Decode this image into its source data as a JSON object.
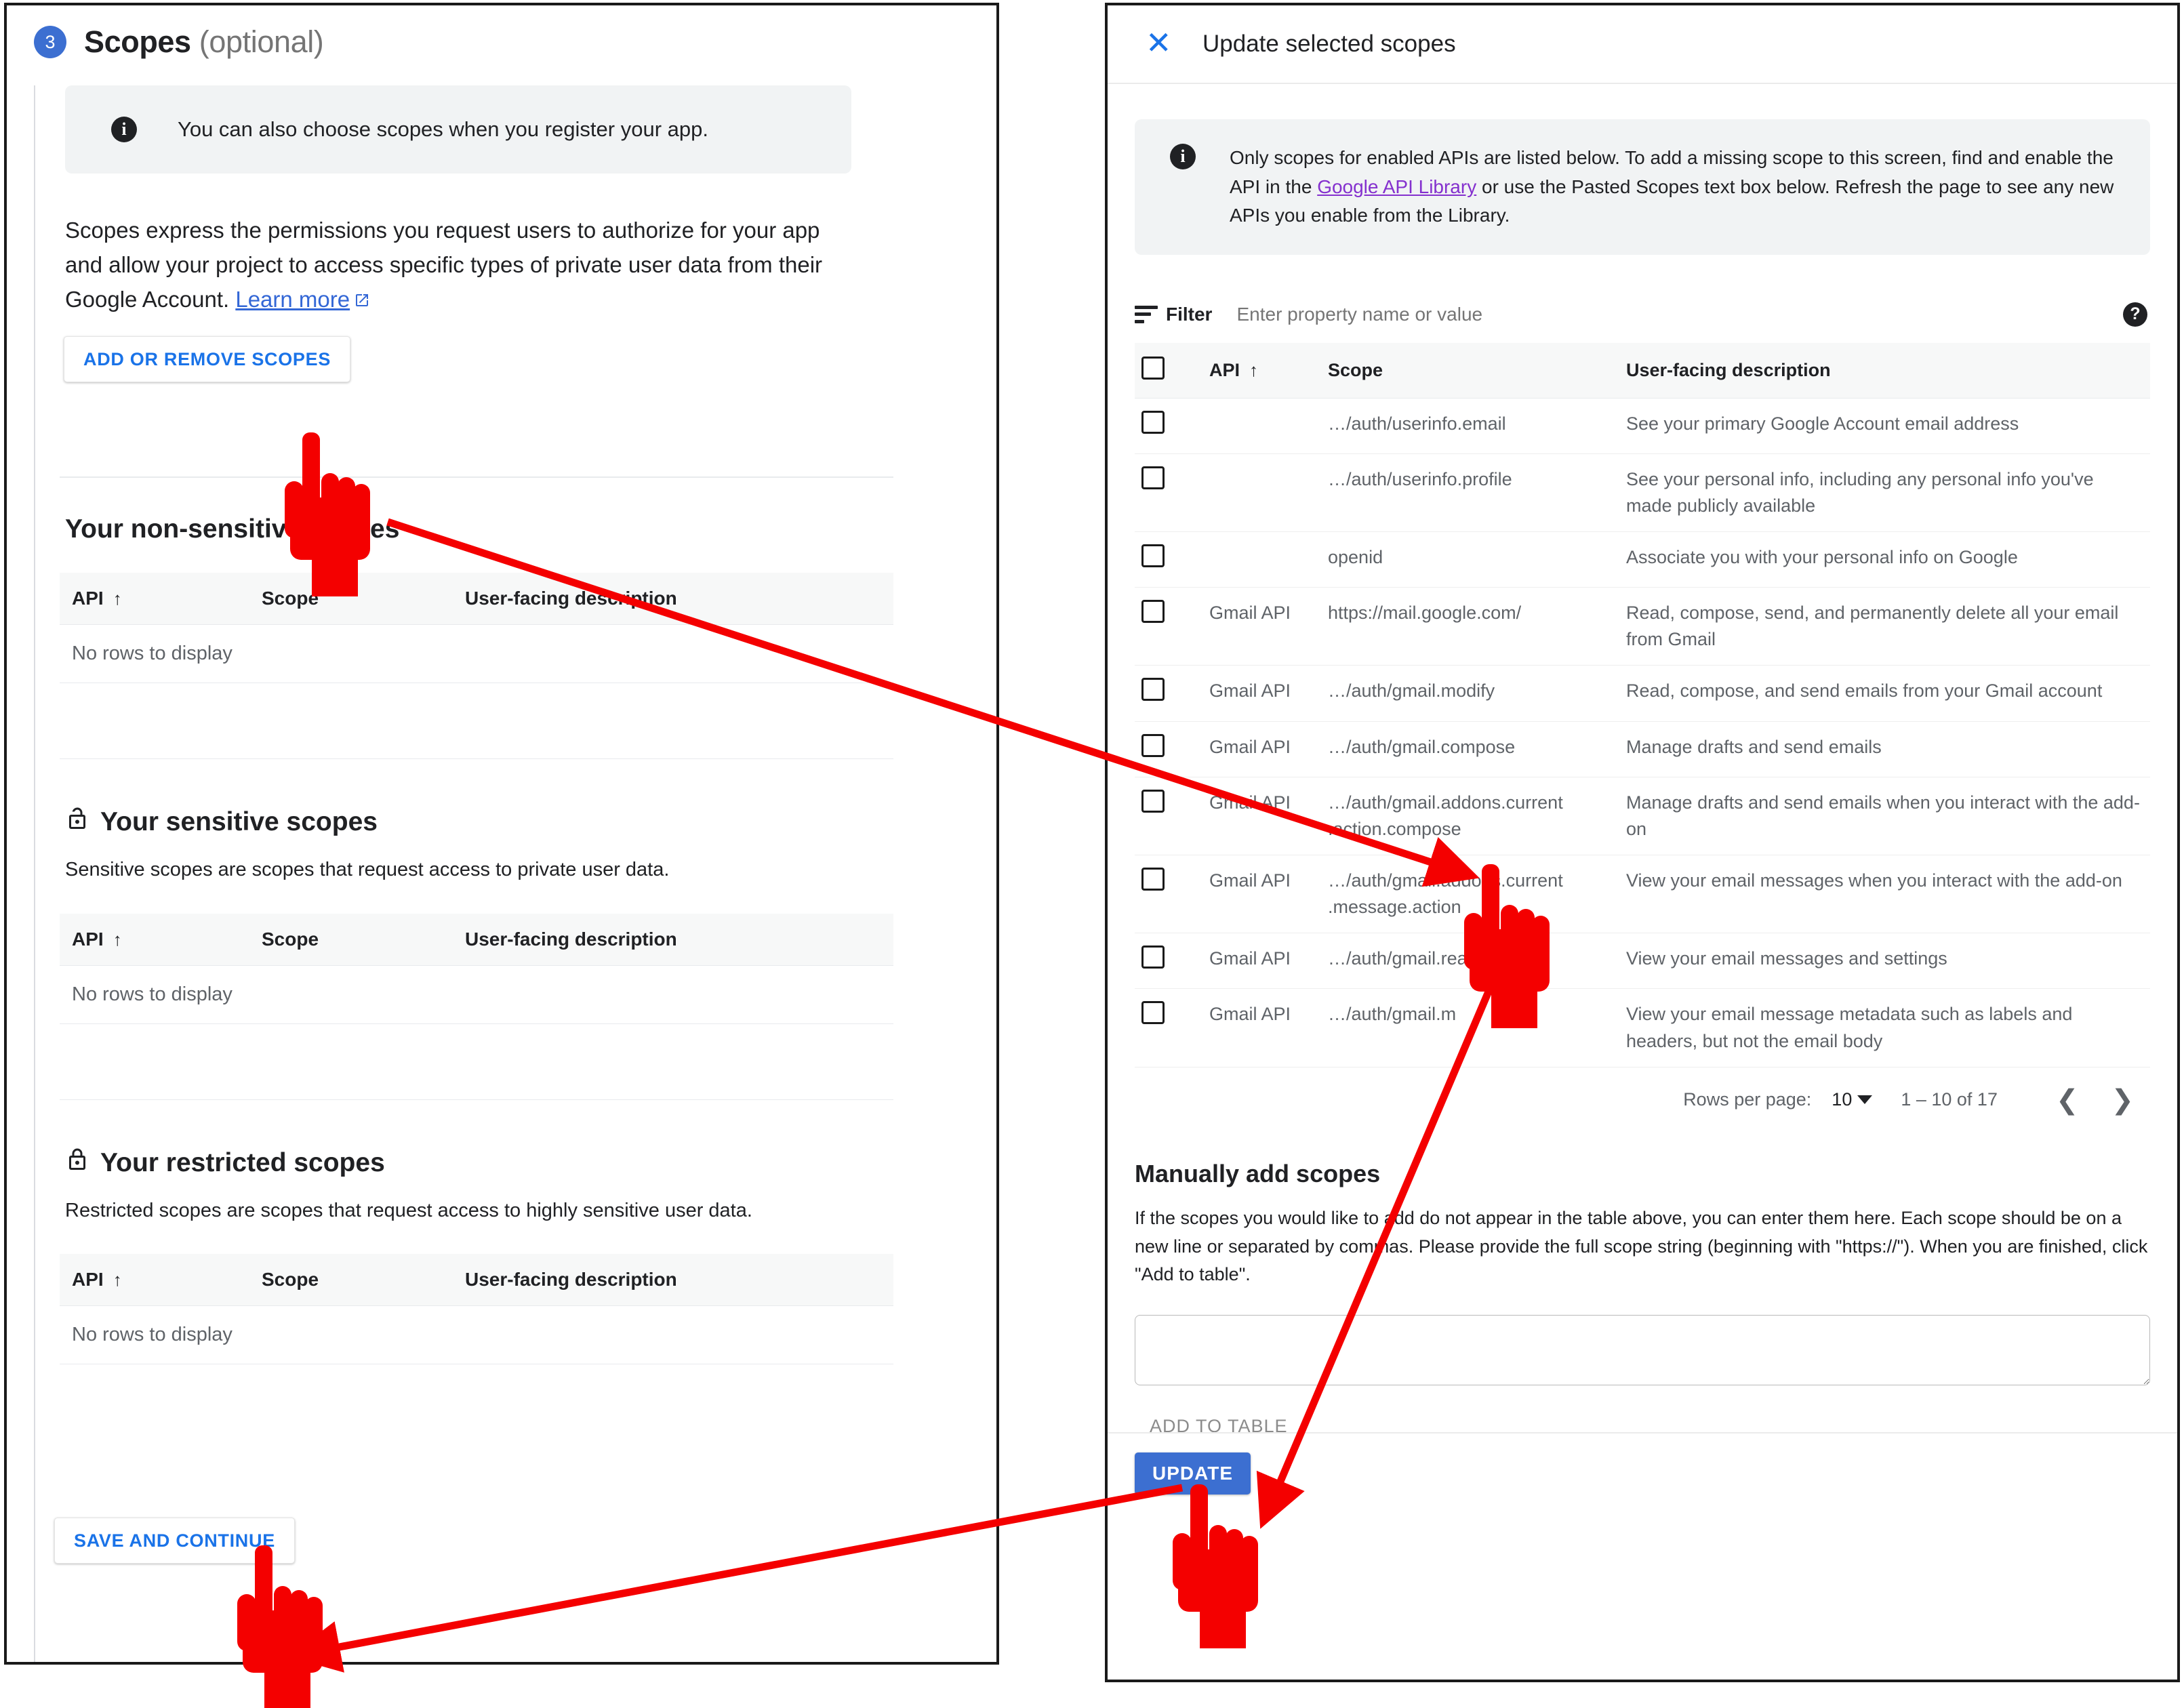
{
  "left": {
    "step_number": "3",
    "title": "Scopes",
    "title_optional": "(optional)",
    "info_text": "You can also choose scopes when you register your app.",
    "paragraph": "Scopes express the permissions you request users to authorize for your app and allow your project to access specific types of private user data from their Google Account. ",
    "learn_more": "Learn more",
    "add_remove_button": "ADD OR REMOVE SCOPES",
    "save_button": "SAVE AND CONTINUE",
    "columns": [
      "API",
      "Scope",
      "User-facing description"
    ],
    "empty_text": "No rows to display",
    "sections": [
      {
        "heading": "Your non-sensitive scopes",
        "subtitle": "",
        "locked": "none"
      },
      {
        "heading": "Your sensitive scopes",
        "subtitle": "Sensitive scopes are scopes that request access to private user data.",
        "locked": "unlocked"
      },
      {
        "heading": "Your restricted scopes",
        "subtitle": "Restricted scopes are scopes that request access to highly sensitive user data.",
        "locked": "locked"
      }
    ]
  },
  "right": {
    "title": "Update selected scopes",
    "info_text_1": "Only scopes for enabled APIs are listed below. To add a missing scope to this screen, find and enable the API in the ",
    "info_link": "Google API Library",
    "info_text_2": " or use the Pasted Scopes text box below. Refresh the page to see any new APIs you enable from the Library.",
    "filter_label": "Filter",
    "filter_placeholder": "Enter property name or value",
    "columns": [
      "API",
      "Scope",
      "User-facing description"
    ],
    "rows": [
      {
        "api": "",
        "scope": "…/auth/userinfo.email",
        "desc": "See your primary Google Account email address"
      },
      {
        "api": "",
        "scope": "…/auth/userinfo.profile",
        "desc": "See your personal info, including any personal info you've made publicly available"
      },
      {
        "api": "",
        "scope": "openid",
        "desc": "Associate you with your personal info on Google"
      },
      {
        "api": "Gmail API",
        "scope": "https://mail.google.com/",
        "desc": "Read, compose, send, and permanently delete all your email from Gmail"
      },
      {
        "api": "Gmail API",
        "scope": "…/auth/gmail.modify",
        "desc": "Read, compose, and send emails from your Gmail account"
      },
      {
        "api": "Gmail API",
        "scope": "…/auth/gmail.compose",
        "desc": "Manage drafts and send emails"
      },
      {
        "api": "Gmail API",
        "scope": "…/auth/gmail.addons.current .action.compose",
        "desc": "Manage drafts and send emails when you interact with the add-on"
      },
      {
        "api": "Gmail API",
        "scope": "…/auth/gmail.addons.current .message.action",
        "desc": "View your email messages when you interact with the add-on"
      },
      {
        "api": "Gmail API",
        "scope": "…/auth/gmail.readonly",
        "desc": "View your email messages and settings"
      },
      {
        "api": "Gmail API",
        "scope": "…/auth/gmail.m",
        "desc": "View your email message metadata such as labels and headers, but not the email body"
      }
    ],
    "pager": {
      "rows_per_page_label": "Rows per page:",
      "rows_per_page_value": "10",
      "range": "1 – 10 of 17"
    },
    "manual": {
      "heading": "Manually add scopes",
      "body": "If the scopes you would like to add do not appear in the table above, you can enter them here. Each scope should be on a new line or separated by commas. Please provide the full scope string (beginning with \"https://\"). When you are finished, click \"Add to table\".",
      "textarea_value": "",
      "add_to_table_button": "ADD TO TABLE"
    },
    "update_button": "UPDATE"
  },
  "annotation": {
    "color": "#f40000",
    "cursor_count": 3,
    "arrow_count": 3
  }
}
